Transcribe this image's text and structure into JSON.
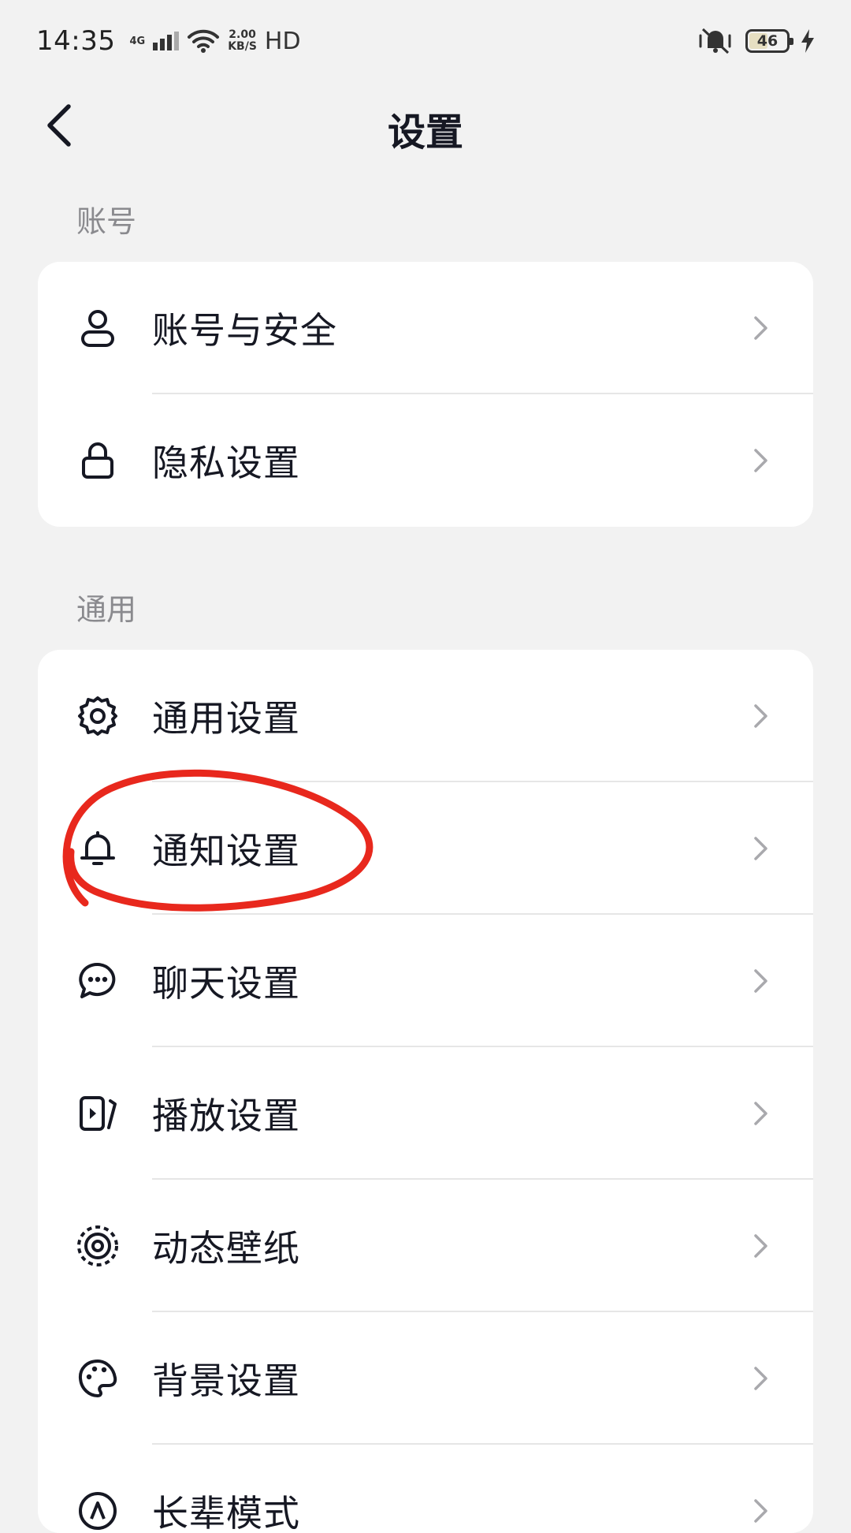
{
  "status_bar": {
    "time": "14:35",
    "network": "4G",
    "speed_value": "2.00",
    "speed_unit": "KB/S",
    "hd": "HD",
    "battery_level": "46",
    "icons": [
      "signal-icon",
      "wifi-icon",
      "mute-vibrate-icon",
      "battery-icon",
      "charging-icon"
    ]
  },
  "nav": {
    "title": "设置",
    "back_icon": "back-arrow-icon"
  },
  "sections": {
    "account": {
      "title": "账号",
      "items": [
        {
          "label": "账号与安全",
          "icon": "person-icon"
        },
        {
          "label": "隐私设置",
          "icon": "lock-icon"
        }
      ]
    },
    "general": {
      "title": "通用",
      "items": [
        {
          "label": "通用设置",
          "icon": "gear-icon"
        },
        {
          "label": "通知设置",
          "icon": "bell-icon"
        },
        {
          "label": "聊天设置",
          "icon": "chat-bubble-icon"
        },
        {
          "label": "播放设置",
          "icon": "play-setting-icon"
        },
        {
          "label": "动态壁纸",
          "icon": "wallpaper-icon"
        },
        {
          "label": "背景设置",
          "icon": "palette-icon"
        },
        {
          "label": "长辈模式",
          "icon": "elder-mode-icon"
        }
      ]
    }
  },
  "colors": {
    "background": "#f2f2f2",
    "card": "#ffffff",
    "text": "#161823",
    "section_title": "#8a8a8e",
    "chevron": "#a9a9ad",
    "annotation": "#e8281d"
  }
}
